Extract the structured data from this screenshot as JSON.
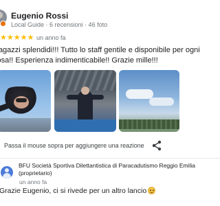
{
  "review": {
    "author_name": "Eugenio Rossi",
    "author_meta": "Local Guide · 6 recensioni · 46 foto",
    "rating_stars": 5,
    "stars_text": "★★★★★",
    "age": "un anno fa",
    "text": "Ragazzi splendidi!!! Tutto lo staff gentile e disponibile per ogni cosa!! Esperienza indimenticabile!! Grazie mille!!!",
    "photos": [
      "skydive-tandem-icon",
      "hangar-person-icon",
      "sky-landscape-icon"
    ],
    "reaction_hint": "Passa il mouse sopra per aggiungere una reazione"
  },
  "owner_reply": {
    "name": "BFU Società Sportiva Dilettantistica di Paracadutismo Reggio Emilia (proprietario)",
    "age": "un anno fa",
    "text": "Grazie Eugenio, ci si rivede per un altro lancio"
  },
  "colors": {
    "star": "#fbbc04",
    "local_guide_badge": "#e8710a",
    "owner_avatar": "#4c7bd9"
  }
}
